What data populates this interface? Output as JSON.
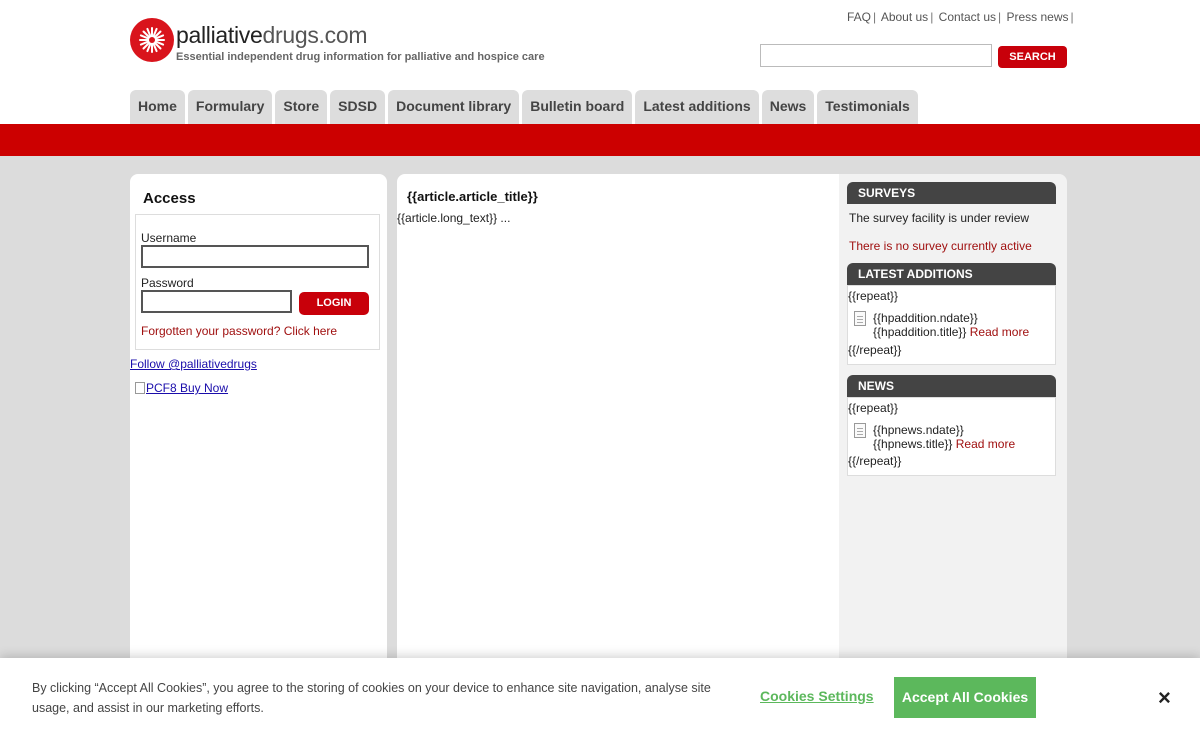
{
  "brand": {
    "name_bold": "palliative",
    "name_light": "drugs.com",
    "tagline": "Essential independent drug information for palliative and hospice care",
    "accent_color": "#cc0000"
  },
  "top_links": [
    "FAQ",
    "About us",
    "Contact us",
    "Press news"
  ],
  "search": {
    "button_label": "SEARCH",
    "value": ""
  },
  "nav": [
    "Home",
    "Formulary",
    "Store",
    "SDSD",
    "Document library",
    "Bulletin board",
    "Latest additions",
    "News",
    "Testimonials"
  ],
  "access": {
    "title": "Access",
    "username_label": "Username",
    "password_label": "Password",
    "login_label": "LOGIN",
    "forgot_label": "Forgotten your password? Click here"
  },
  "follow_label": "Follow @palliativedrugs",
  "pcf8_label": "PCF8 Buy Now",
  "article": {
    "title": "{{article.article_title}}",
    "text": "{{article.long_text}} ..."
  },
  "surveys": {
    "heading": "SURVEYS",
    "line1": "The survey facility is under review",
    "line2": "There is no survey currently active"
  },
  "latest_additions": {
    "heading": "LATEST ADDITIONS",
    "repeat_open": "{{repeat}}",
    "date": "{{hpaddition.ndate}}",
    "title": "{{hpaddition.title}}",
    "read_more": "Read more",
    "repeat_close": "{{/repeat}}"
  },
  "news": {
    "heading": "NEWS",
    "repeat_open": "{{repeat}}",
    "date": "{{hpnews.ndate}}",
    "title": "{{hpnews.title}}",
    "read_more": "Read more",
    "repeat_close": "{{/repeat}}"
  },
  "cookie": {
    "text": "By clicking “Accept All Cookies”, you agree to the storing of cookies on your device to enhance site navigation, analyse site usage, and assist in our marketing efforts.",
    "settings_label": "Cookies Settings",
    "accept_label": "Accept All Cookies",
    "close_label": "×"
  }
}
